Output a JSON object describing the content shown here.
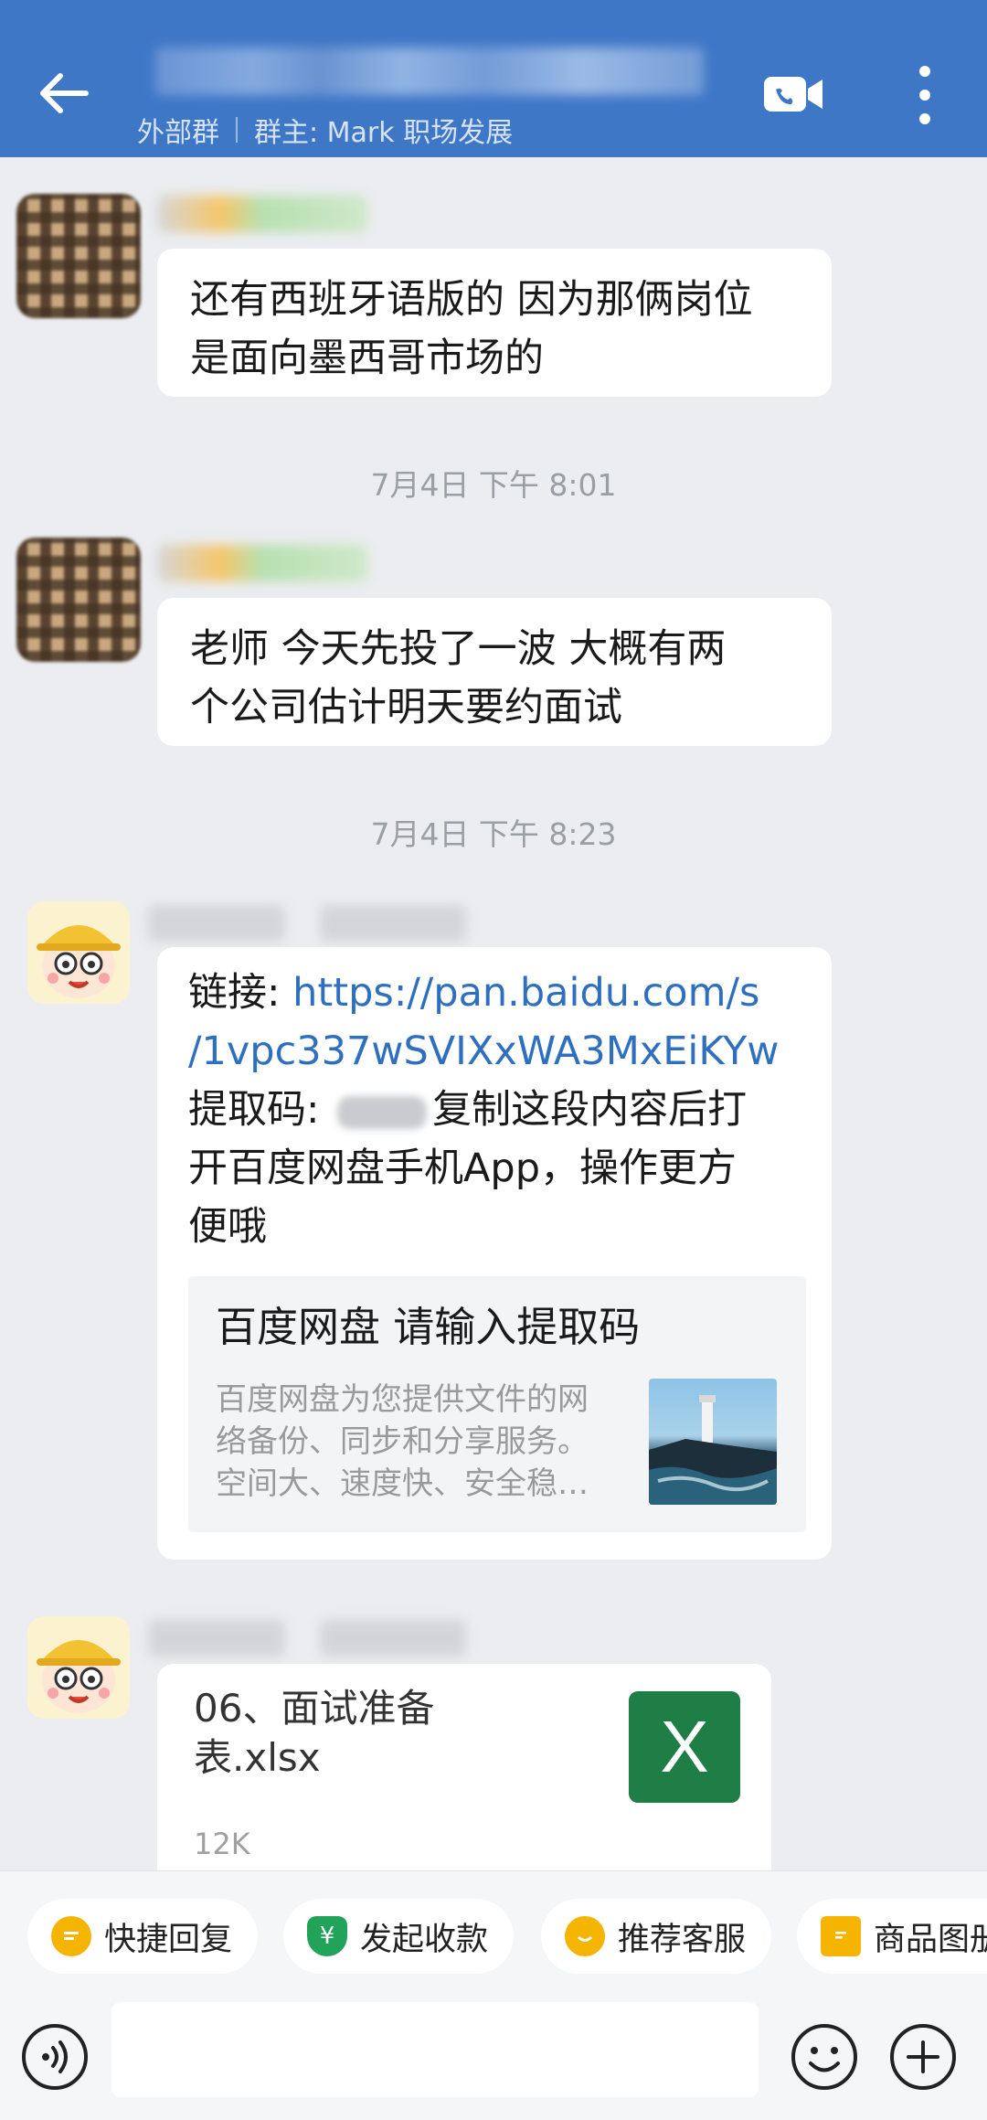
{
  "header": {
    "subtitle_group": "外部群",
    "subtitle_owner": "群主: Mark 职场发展",
    "bg_color": "#3f77c7"
  },
  "messages": {
    "m1_text_line1": "还有西班牙语版的 因为那俩岗位",
    "m1_text_line2": "是面向墨西哥市场的",
    "t1": "7月4日  下午 8:01",
    "m2_text_line1": "老师 今天先投了一波 大概有两",
    "m2_text_line2": "个公司估计明天要约面试",
    "t2": "7月4日  下午 8:23",
    "m3_prefix": "链接: ",
    "m3_link_line1": "https://pan.baidu.com/s",
    "m3_link_line2": "/1vpc337wSVIXxWA3MxEiKYw",
    "m3_code_label": "提取码: ",
    "m3_after_code": "复制这段内容后打",
    "m3_line4": "开百度网盘手机App，操作更方",
    "m3_line5": "便哦",
    "card_title": "百度网盘 请输入提取码",
    "card_desc_line1": "百度网盘为您提供文件的网",
    "card_desc_line2": "络备份、同步和分享服务。",
    "card_desc_line3": "空间大、速度快、安全稳…",
    "file_name_line1": "06、面试准备",
    "file_name_line2": "表.xlsx",
    "file_size": "12K",
    "file_icon_letter": "X"
  },
  "quick_replies": {
    "c1": "快捷回复",
    "c2": "发起收款",
    "c3": "推荐客服",
    "c4": "商品图册"
  },
  "icons": {
    "back": "arrow-left-icon",
    "video": "video-call-icon",
    "more": "more-vertical-icon",
    "voice": "voice-icon",
    "emoji": "emoji-icon",
    "plus": "plus-icon"
  }
}
